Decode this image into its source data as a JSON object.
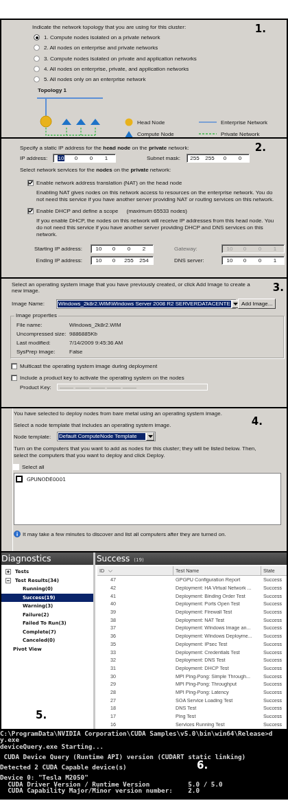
{
  "topology": {
    "step": "1.",
    "prompt": "Indicate the network topology that you are using for this cluster:",
    "options": [
      {
        "label": "1. Compute nodes isolated on a private network",
        "selected": true
      },
      {
        "label": "2. All nodes on enterprise and private networks",
        "selected": false
      },
      {
        "label": "3. Compute nodes isolated on private and application networks",
        "selected": false
      },
      {
        "label": "4. All nodes on enterprise, private, and application networks",
        "selected": false
      },
      {
        "label": "5. All nodes only on an enterprise network",
        "selected": false
      }
    ],
    "diagram_title": "Topology 1",
    "legend": [
      {
        "kind": "head",
        "label": "Head Node"
      },
      {
        "kind": "enterprise",
        "label": "Enterprise Network"
      },
      {
        "kind": "compute",
        "label": "Compute Node"
      },
      {
        "kind": "private",
        "label": "Private Network"
      }
    ]
  },
  "network": {
    "step": "2.",
    "intro": "Specify a static IP address for the **head node** on the **private** network:",
    "address_fields": [
      {
        "label": "IP address:",
        "octets": [
          "10",
          "0",
          "0",
          "1"
        ],
        "focused": true
      },
      {
        "label": "Subnet mask:",
        "octets": [
          "255",
          "255",
          "0",
          "0"
        ],
        "focused": false
      }
    ],
    "services_intro": "Select network services for the **nodes** on the **private** network:",
    "services": [
      {
        "label": "Enable network address translation (NAT) on the head node",
        "checked": true,
        "description": "Enabling NAT gives nodes on this network access to resources on the enterprise network. You do not need this service if you have another server providing NAT or routing services on this network."
      },
      {
        "label": "Enable DHCP and define a scope",
        "note": "(maximum 65533 nodes)",
        "checked": true,
        "description": "If you enable DHCP, the nodes on this network will receive IP addresses from this head node. You do not need this service if you have another server providing DHCP and DNS services on this network."
      }
    ],
    "scope_fields": [
      {
        "label": "Starting IP address:",
        "octets": [
          "10",
          "0",
          "0",
          "2"
        ],
        "disabled": false
      },
      {
        "label": "Gateway:",
        "octets": [
          "10",
          "0",
          "0",
          "1"
        ],
        "disabled": true
      },
      {
        "label": "Ending IP address:",
        "octets": [
          "10",
          "0",
          "255",
          "254"
        ],
        "disabled": false
      },
      {
        "label": "DNS server:",
        "octets": [
          "10",
          "0",
          "0",
          "1"
        ],
        "disabled": false
      }
    ]
  },
  "os_image": {
    "step": "3.",
    "prompt": "Select an operating system image that you have previously created, or click Add Image to create a new image.",
    "image_name": {
      "label": "Image Name:",
      "value": "Windows_2k8r2.WIM\\Windows Server 2008 R2 SERVERDATACENTE",
      "selected": true
    },
    "add_button": "Add Image...",
    "properties": {
      "title": "Image properties",
      "rows": [
        {
          "label": "File name:",
          "value": "Windows_2k8r2.WIM"
        },
        {
          "label": "Uncompressed size:",
          "value": "9886885Kb"
        },
        {
          "label": "Last modified:",
          "value": "7/14/2009 9:45:36 AM"
        },
        {
          "label": "SysPrep image:",
          "value": "False"
        }
      ]
    },
    "options": [
      {
        "label": "Multicast the operating system image during deployment",
        "checked": false
      },
      {
        "label": "Include a product key to activate the operating system on the nodes",
        "checked": false
      }
    ],
    "product_key": {
      "label": "Product Key:",
      "disabled": true
    }
  },
  "deploy": {
    "step": "4.",
    "intro": "You have selected to deploy nodes from bare metal using an operating system image.",
    "template_prompt": "Select a node template that includes an operating system image.",
    "node_template": {
      "label": "Node template:",
      "value": "Default ComputeNode Template",
      "selected": true
    },
    "instructions": "Turn on the computers that you want to add as nodes for this cluster; they will be listed below. Then, select the computers that you want to deploy and click Deploy.",
    "select_all": {
      "label": "Select all",
      "checked": false
    },
    "nodes": [
      {
        "label": "GPUNODE0001",
        "checked": false
      }
    ],
    "info": "It may take a few minutes to discover and list all computers after they are turned on."
  },
  "diagnostics": {
    "step": "5.",
    "title": "Diagnostics",
    "tree": [
      {
        "label": "Tests",
        "expanded": false,
        "selected": false
      },
      {
        "label": "Test Results(34)",
        "expanded": true,
        "selected": false,
        "children": [
          {
            "label": "Running(0)",
            "selected": false
          },
          {
            "label": "Success(19)",
            "selected": true
          },
          {
            "label": "Warning(3)",
            "selected": false
          },
          {
            "label": "Failure(2)",
            "selected": false
          },
          {
            "label": "Failed To Run(3)",
            "selected": false
          },
          {
            "label": "Complete(7)",
            "selected": false
          },
          {
            "label": "Canceled(0)",
            "selected": false
          }
        ]
      },
      {
        "label": "Pivot View",
        "selected": false
      }
    ],
    "table": {
      "title": "Success",
      "count": "(19)",
      "columns": [
        "ID",
        "Test Name",
        "State"
      ],
      "rows": [
        {
          "id": "47",
          "name": "GPGPU Configuration Report",
          "state": "Success"
        },
        {
          "id": "42",
          "name": "Deployment: HA Virtual Network ...",
          "state": "Success"
        },
        {
          "id": "41",
          "name": "Deployment: Binding Order Test",
          "state": "Success"
        },
        {
          "id": "40",
          "name": "Deployment: Ports Open Test",
          "state": "Success"
        },
        {
          "id": "39",
          "name": "Deployment: Firewall Test",
          "state": "Success"
        },
        {
          "id": "38",
          "name": "Deployment: NAT Test",
          "state": "Success"
        },
        {
          "id": "37",
          "name": "Deployment: Windows Image an...",
          "state": "Success"
        },
        {
          "id": "36",
          "name": "Deployment: Windows Deployme...",
          "state": "Success"
        },
        {
          "id": "35",
          "name": "Deployment: IPsec Test",
          "state": "Success"
        },
        {
          "id": "33",
          "name": "Deployment: Credentials Test",
          "state": "Success"
        },
        {
          "id": "32",
          "name": "Deployment: DNS Test",
          "state": "Success"
        },
        {
          "id": "31",
          "name": "Deployment: DHCP Test",
          "state": "Success"
        },
        {
          "id": "30",
          "name": "MPI Ping-Pong: Simple Through...",
          "state": "Success"
        },
        {
          "id": "29",
          "name": "MPI Ping-Pong: Throughput",
          "state": "Success"
        },
        {
          "id": "28",
          "name": "MPI Ping-Pong: Latency",
          "state": "Success"
        },
        {
          "id": "27",
          "name": "SOA Service Loading Test",
          "state": "Success"
        },
        {
          "id": "18",
          "name": "DNS Test",
          "state": "Success"
        },
        {
          "id": "17",
          "name": "Ping Test",
          "state": "Success"
        },
        {
          "id": "16",
          "name": "Services Running Test",
          "state": "Success"
        }
      ]
    }
  },
  "console": {
    "step": "6.",
    "lines": [
      {
        "text": "C:\\ProgramData\\NVIDIA Corporation\\CUDA Samples\\v5.0\\bin\\win64\\Release>d",
        "gap_before": false
      },
      {
        "text": "y.exe",
        "gap_before": false
      },
      {
        "text": "deviceQuery.exe Starting...",
        "gap_before": false
      },
      {
        "text": " CUDA Device Query (Runtime API) version (CUDART static linking)",
        "gap_before": true
      },
      {
        "text": "Detected 2 CUDA Capable device(s)",
        "gap_before": true
      },
      {
        "text": "Device 0: \"Tesla M2050\"",
        "gap_before": true
      },
      {
        "text": "  CUDA Driver Version / Runtime Version          5.0 / 5.0",
        "gap_before": false
      },
      {
        "text": "  CUDA Capability Major/Minor version number:    2.0",
        "gap_before": false
      }
    ]
  }
}
